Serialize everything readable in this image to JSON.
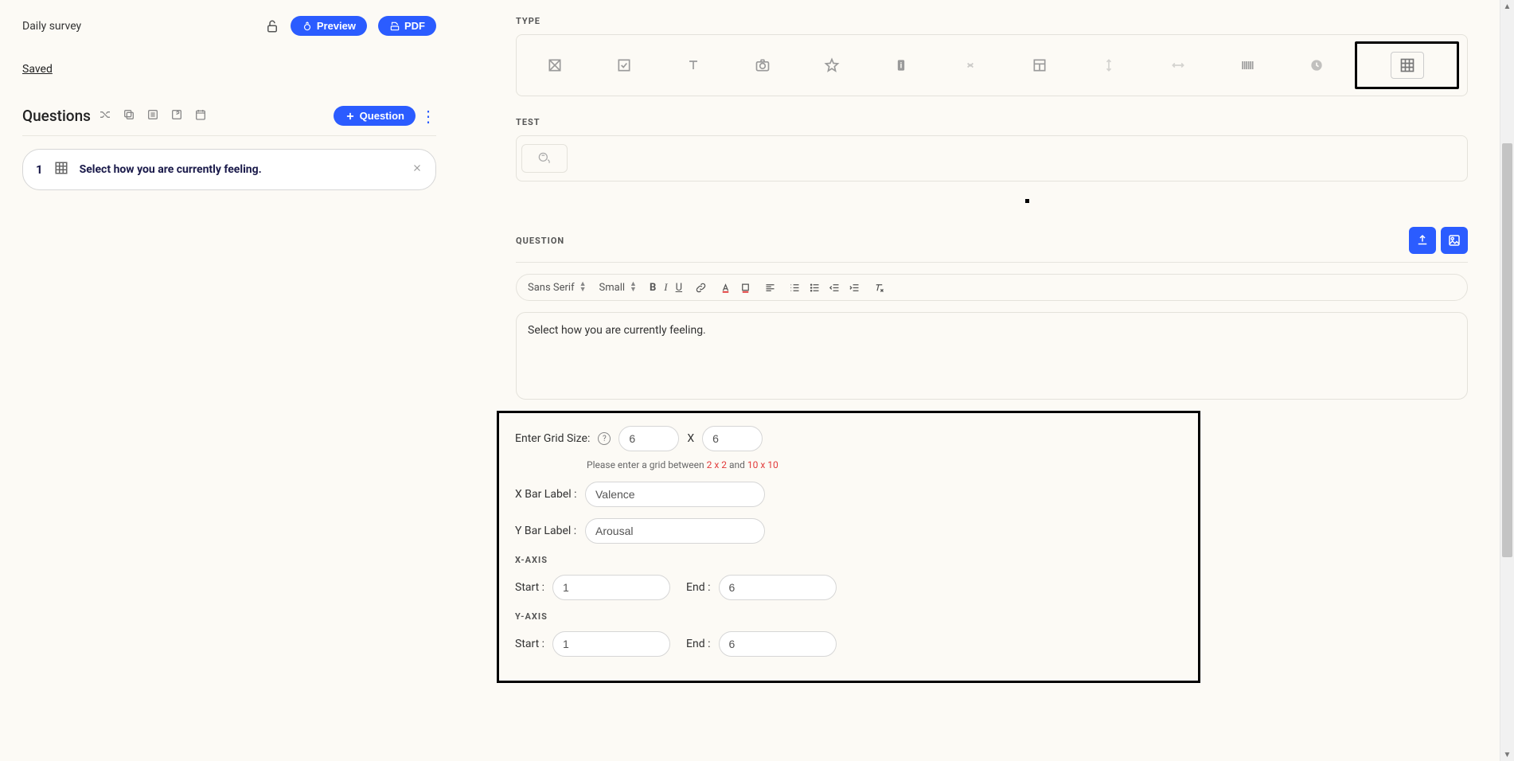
{
  "header": {
    "survey_title": "Daily survey",
    "preview_label": "Preview",
    "pdf_label": "PDF",
    "saved_label": "Saved"
  },
  "questions_panel": {
    "title": "Questions",
    "add_question_label": "Question",
    "items": [
      {
        "num": "1",
        "text": "Select how you are currently feeling."
      }
    ]
  },
  "right": {
    "type_label": "TYPE",
    "test_label": "TEST",
    "question_label": "QUESTION",
    "editor": {
      "font_family": "Sans Serif",
      "font_size": "Small",
      "body_text": "Select how you are currently feeling."
    },
    "grid_config": {
      "enter_grid_size_label": "Enter Grid Size:",
      "grid_x_value": "6",
      "grid_y_value": "6",
      "separator": "X",
      "hint_prefix": "Please enter a grid between ",
      "hint_min": "2 x 2",
      "hint_mid": " and ",
      "hint_max": "10 x 10",
      "x_bar_label_text": "X Bar Label :",
      "x_bar_value": "Valence",
      "y_bar_label_text": "Y Bar Label :",
      "y_bar_value": "Arousal",
      "x_axis_label": "X-AXIS",
      "y_axis_label": "Y-AXIS",
      "start_label": "Start :",
      "end_label": "End :",
      "x_start": "1",
      "x_end": "6",
      "y_start": "1",
      "y_end": "6"
    }
  }
}
